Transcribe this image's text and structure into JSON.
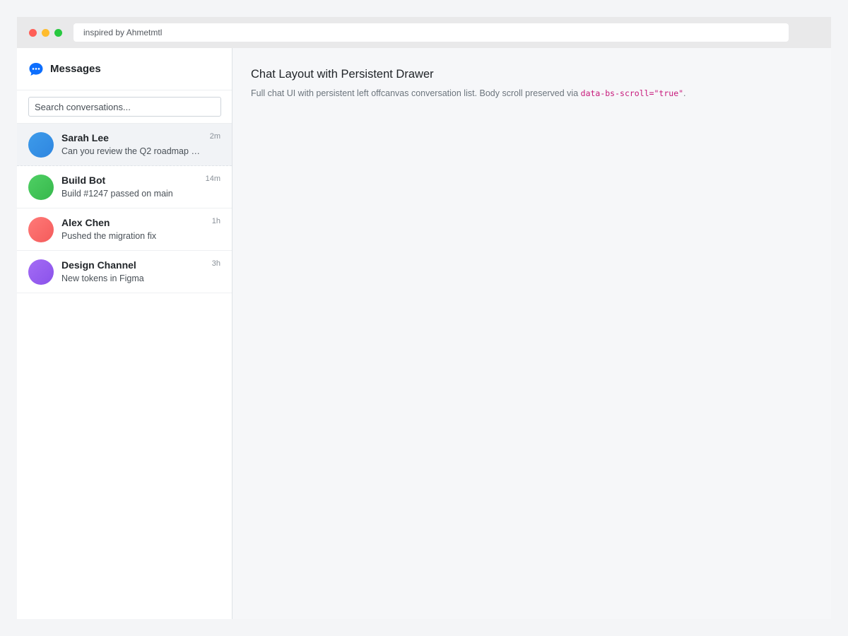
{
  "window": {
    "url_bar_text": "inspired by Ahmetmtl",
    "traffic_lights": [
      "#ff5f57",
      "#febc2e",
      "#28c840"
    ]
  },
  "sidebar": {
    "title": "Messages",
    "title_icon": "chat-bubble-icon",
    "search_placeholder": "Search conversations...",
    "conversations": [
      {
        "name": "Sarah Lee",
        "preview": "Can you review the Q2 roadmap b...",
        "time": "2m",
        "active": true,
        "avatar_colors": [
          "#3d9bea",
          "#2f86e0"
        ]
      },
      {
        "name": "Build Bot",
        "preview": "Build #1247 passed on main",
        "time": "14m",
        "active": false,
        "avatar_colors": [
          "#4fd064",
          "#36b84c"
        ]
      },
      {
        "name": "Alex Chen",
        "preview": "Pushed the migration fix",
        "time": "1h",
        "active": false,
        "avatar_colors": [
          "#ff7a78",
          "#f45b5b"
        ]
      },
      {
        "name": "Design Channel",
        "preview": "New tokens in Figma",
        "time": "3h",
        "active": false,
        "avatar_colors": [
          "#a46cf5",
          "#8a52ea"
        ]
      }
    ]
  },
  "main": {
    "title": "Chat Layout with Persistent Drawer",
    "description_prefix": "Full chat UI with persistent left offcanvas conversation list. Body scroll preserved via ",
    "description_code": "data-bs-scroll=\"true\"",
    "description_suffix": "."
  },
  "colors": {
    "accent": "#0d6efd",
    "code": "#c7197b"
  }
}
